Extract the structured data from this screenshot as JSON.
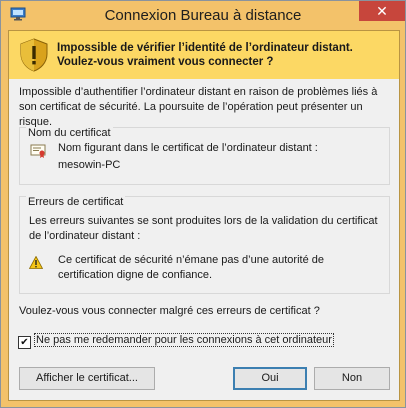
{
  "window": {
    "title": "Connexion Bureau à distance",
    "close_glyph": "✕",
    "app_icon": "remote-desktop-icon"
  },
  "banner": {
    "icon": "security-shield-warning-icon",
    "text": "Impossible de vérifier l’identité de l’ordinateur distant.\nVoulez-vous vraiment vous connecter ?"
  },
  "intro": {
    "text": "Impossible d’authentifier l’ordinateur distant en raison de problèmes liés à son certificat de sécurité. La poursuite de l’opération peut présenter un risque."
  },
  "cert_name": {
    "group_title": "Nom du certificat",
    "icon": "certificate-icon",
    "label": "Nom figurant dans le certificat de l’ordinateur distant :",
    "value": "mesowin-PC"
  },
  "cert_errors": {
    "group_title": "Erreurs de certificat",
    "description": "Les erreurs suivantes se sont produites lors de la validation du certificat de l’ordinateur distant :",
    "icon": "warning-icon",
    "error": "Ce certificat de sécurité n’émane pas d’une autorité de certification digne de confiance."
  },
  "question": "Voulez-vous vous connecter malgré ces erreurs de certificat ?",
  "checkbox": {
    "label": "Ne pas me redemander pour les connexions à cet ordinateur",
    "checked": true,
    "glyph": "✔"
  },
  "buttons": {
    "view_cert": "Afficher le certificat...",
    "yes": "Oui",
    "no": "Non"
  },
  "colors": {
    "title_bar": "#f3c26a",
    "banner": "#fcd864",
    "close_button": "#c7463c"
  }
}
